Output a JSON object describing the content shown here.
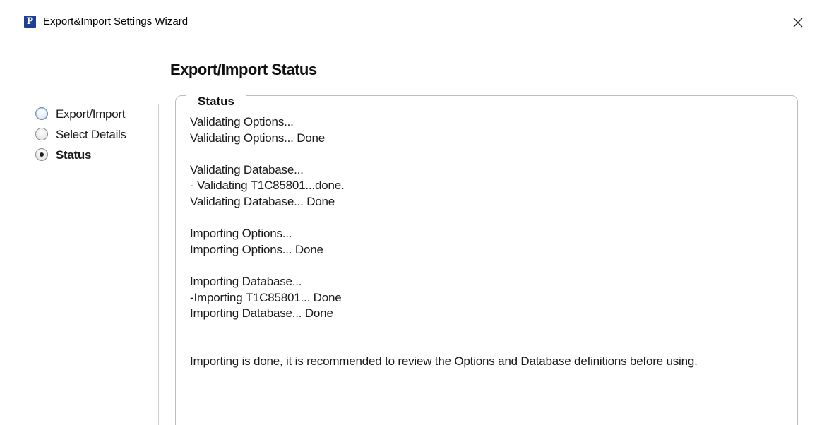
{
  "window": {
    "title": "Export&Import Settings Wizard",
    "app_icon_letter": "P",
    "close_glyph": "×"
  },
  "page": {
    "title": "Export/Import Status"
  },
  "steps": {
    "items": [
      {
        "label": "Export/Import",
        "state": "hover"
      },
      {
        "label": "Select Details",
        "state": "unselected"
      },
      {
        "label": "Status",
        "state": "selected"
      }
    ]
  },
  "status": {
    "legend": "Status",
    "lines": [
      "Validating Options...",
      "Validating Options... Done",
      "",
      "Validating Database...",
      "- Validating T1C85801...done.",
      "Validating Database... Done",
      "",
      "Importing Options...",
      "Importing Options... Done",
      "",
      "Importing Database...",
      "-Importing T1C85801... Done",
      "Importing Database... Done",
      "",
      "",
      "Importing is done, it is recommended to review the Options and Database definitions before using."
    ]
  },
  "colors": {
    "app_icon_bg": "#1d3f95",
    "border": "#bdbdbd",
    "text": "#1a1a1a"
  },
  "icons": {
    "app": "app-logo-icon",
    "close": "close-icon"
  }
}
